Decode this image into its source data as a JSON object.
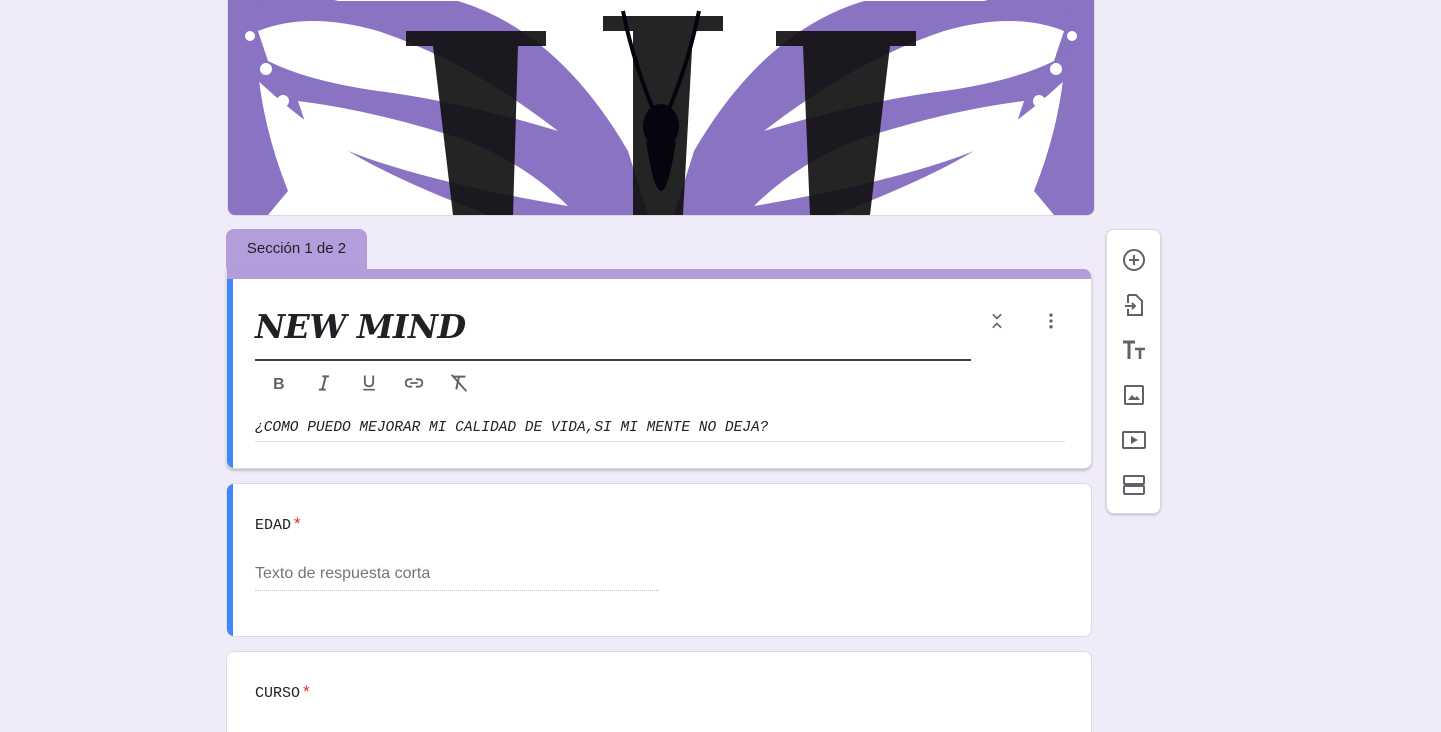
{
  "section": {
    "tab_label": "Sección 1 de 2"
  },
  "form": {
    "title": "NEW MIND",
    "description": "¿COMO PUEDO MEJORAR MI CALIDAD DE VIDA,SI MI MENTE NO DEJA?"
  },
  "questions": [
    {
      "title": "EDAD",
      "required_mark": "*",
      "placeholder": "Texto de respuesta corta"
    },
    {
      "title": "CURSO",
      "required_mark": "*"
    }
  ],
  "format_toolbar": [
    "bold-icon",
    "italic-icon",
    "underline-icon",
    "link-icon",
    "clear-format-icon"
  ],
  "side_toolbar": [
    "add-question-icon",
    "import-questions-icon",
    "add-title-icon",
    "add-image-icon",
    "add-video-icon",
    "add-section-icon"
  ],
  "colors": {
    "background": "#f0ebf8",
    "theme": "#b39ddb",
    "accent": "#4285f4",
    "required": "#d93025",
    "banner_purple": "#8b73c3"
  }
}
